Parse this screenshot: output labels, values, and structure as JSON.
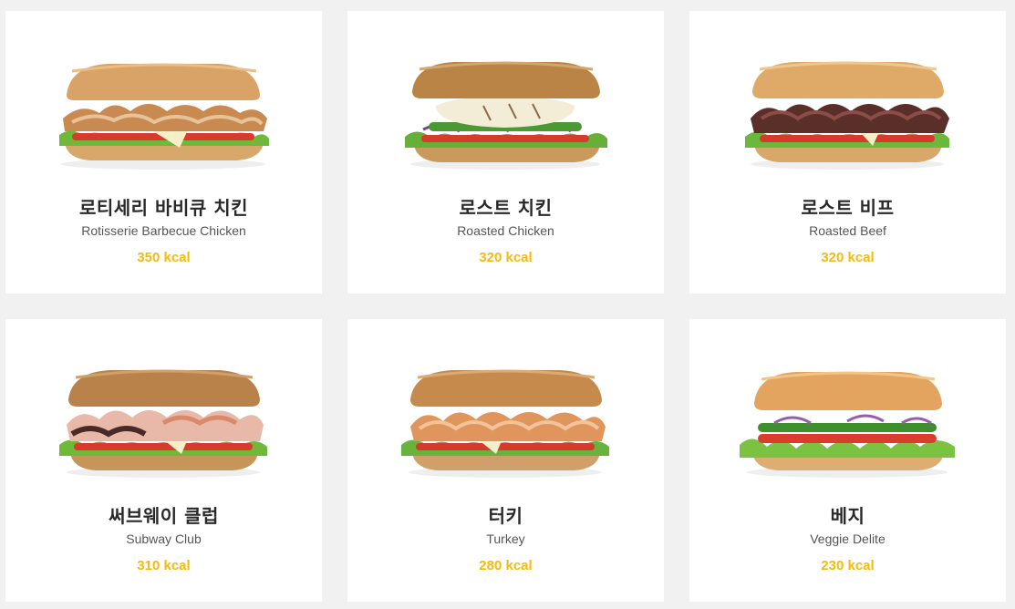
{
  "menu": {
    "items": [
      {
        "name_ko": "로티세리 바비큐 치킨",
        "name_en": "Rotisserie Barbecue Chicken",
        "kcal": "350 kcal",
        "image": "rotisserie-barbecue-chicken-sandwich"
      },
      {
        "name_ko": "로스트 치킨",
        "name_en": "Roasted Chicken",
        "kcal": "320 kcal",
        "image": "roasted-chicken-sandwich"
      },
      {
        "name_ko": "로스트 비프",
        "name_en": "Roasted Beef",
        "kcal": "320 kcal",
        "image": "roasted-beef-sandwich"
      },
      {
        "name_ko": "써브웨이 클럽",
        "name_en": "Subway Club",
        "kcal": "310 kcal",
        "image": "subway-club-sandwich"
      },
      {
        "name_ko": "터키",
        "name_en": "Turkey",
        "kcal": "280 kcal",
        "image": "turkey-sandwich"
      },
      {
        "name_ko": "베지",
        "name_en": "Veggie Delite",
        "kcal": "230 kcal",
        "image": "veggie-delite-sandwich"
      }
    ]
  },
  "colors": {
    "background": "#f1f1f1",
    "card": "#ffffff",
    "kcal_accent": "#f6b90e",
    "title_text": "#292929",
    "subtitle_text": "#555555"
  }
}
